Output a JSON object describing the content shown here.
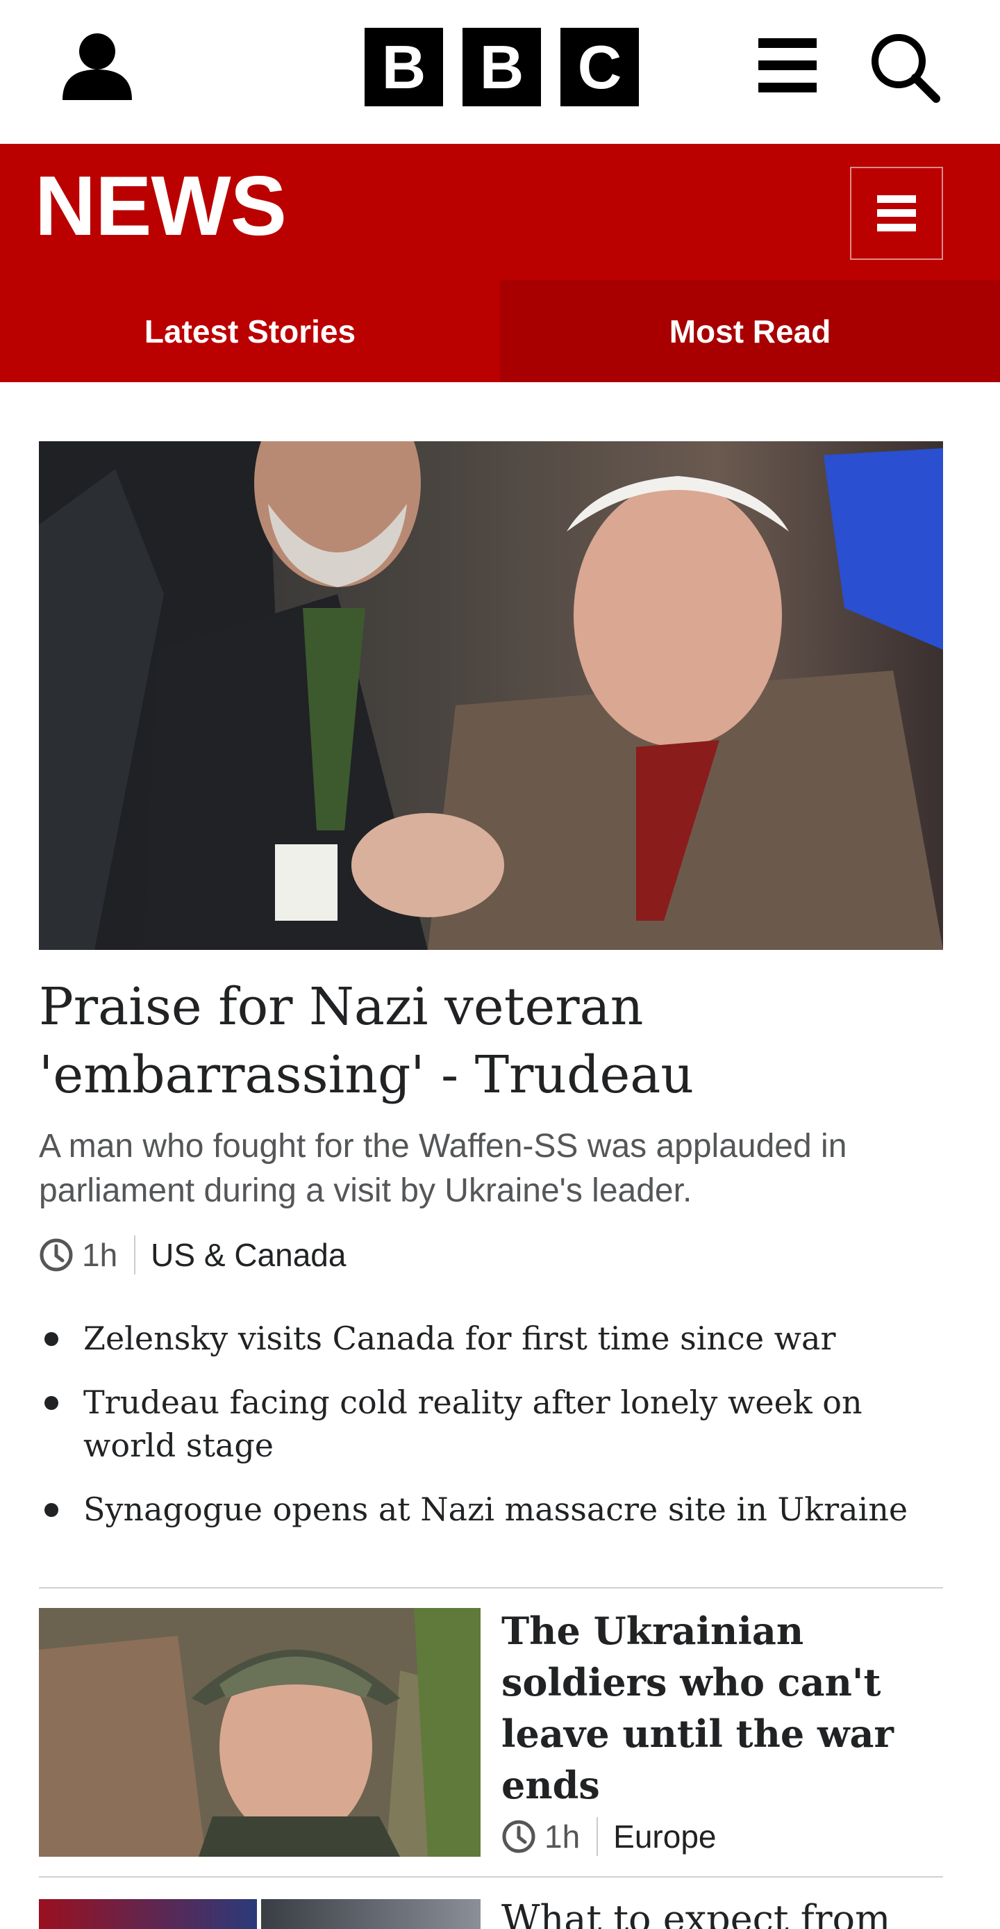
{
  "brand": {
    "logo_letters": [
      "B",
      "B",
      "C"
    ],
    "section_title": "NEWS"
  },
  "tabs": [
    {
      "label": "Latest Stories",
      "active": false
    },
    {
      "label": "Most Read",
      "active": true
    }
  ],
  "colors": {
    "news_red": "#bb0000",
    "tab_active_red": "#a80000",
    "text_primary": "#202224",
    "text_secondary": "#545658"
  },
  "icons": {
    "account": "account-icon",
    "menu": "menu-icon",
    "search": "search-icon",
    "news_menu": "news-menu-icon",
    "clock": "clock-icon"
  },
  "hero": {
    "headline": "Praise for Nazi veteran 'embarrassing' - Trudeau",
    "summary": "A man who fought for the Waffen-SS was applauded in parliament during a visit by Ukraine's leader.",
    "time": "1h",
    "section": "US & Canada",
    "related": [
      "Zelensky visits Canada for first time since war",
      "Trudeau facing cold reality after lonely week on world stage",
      "Synagogue opens at Nazi massacre site in Ukraine"
    ]
  },
  "stories": [
    {
      "headline": "The Ukrainian soldiers who can't leave until the war ends",
      "time": "1h",
      "section": "Europe"
    },
    {
      "headline": "What to expect from"
    }
  ]
}
